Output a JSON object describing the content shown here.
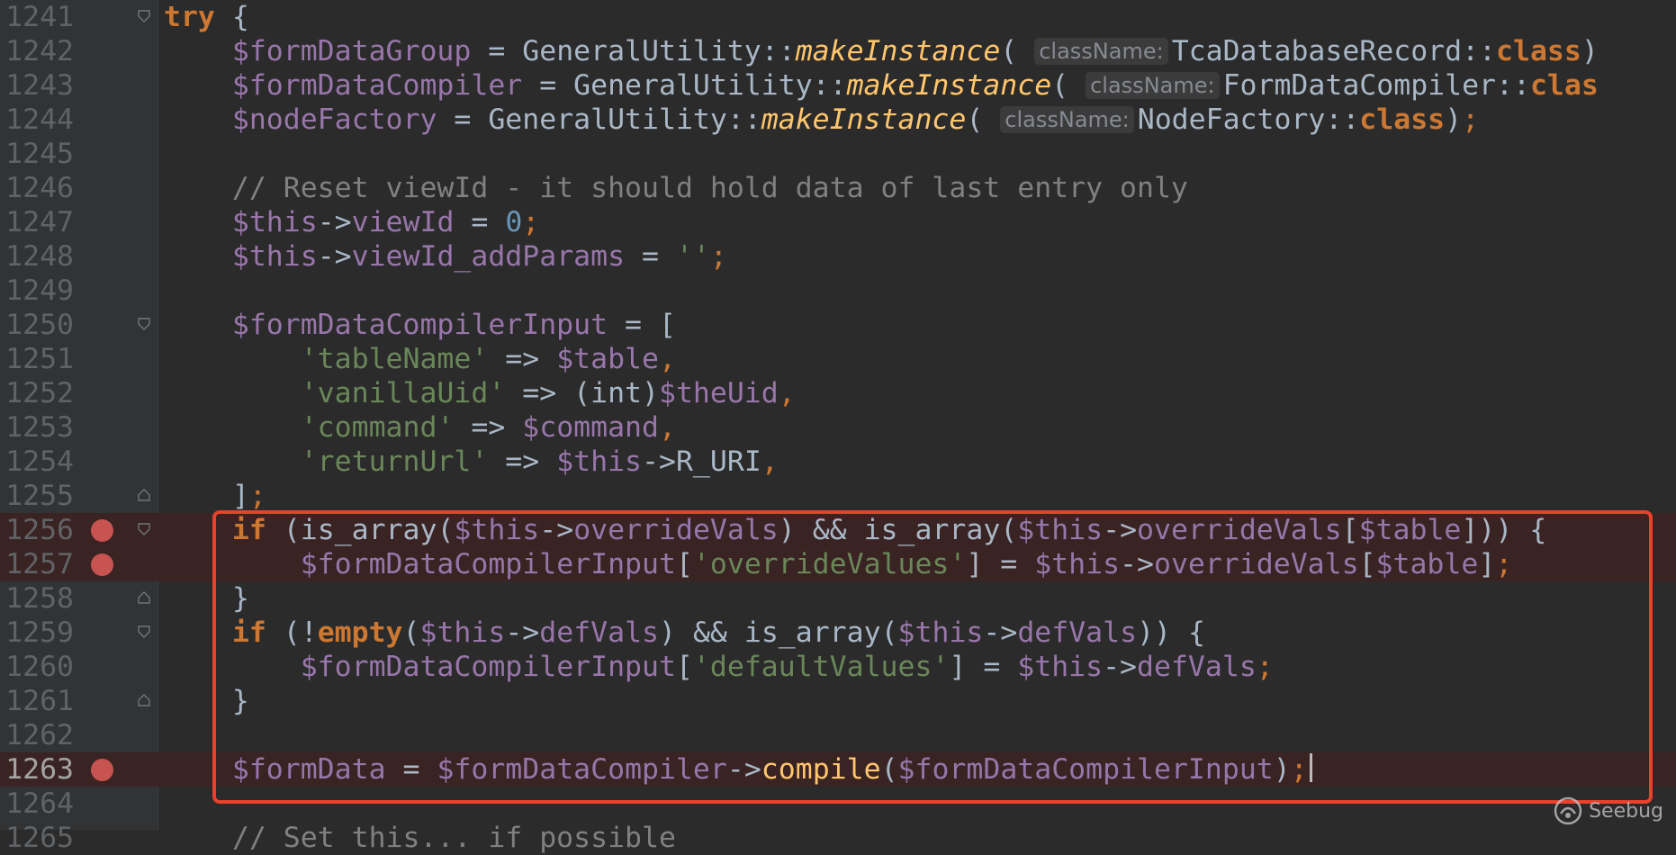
{
  "editor": {
    "watermark": "Seebug",
    "lines": [
      {
        "num": "1241",
        "fold": "open",
        "bp": false,
        "tokens": [
          [
            "kw",
            "try"
          ],
          [
            "t",
            " {"
          ]
        ]
      },
      {
        "num": "1242",
        "fold": "",
        "bp": false,
        "tokens": [
          [
            "t",
            "    "
          ],
          [
            "var",
            "$formDataGroup"
          ],
          [
            "t",
            " = GeneralUtility::"
          ],
          [
            "static",
            "makeInstance"
          ],
          [
            "t",
            "( "
          ],
          [
            "hint",
            "className:"
          ],
          [
            "t",
            "TcaDatabaseRecord::"
          ],
          [
            "kw",
            "class"
          ],
          [
            "t",
            ")"
          ]
        ]
      },
      {
        "num": "1243",
        "fold": "",
        "bp": false,
        "tokens": [
          [
            "t",
            "    "
          ],
          [
            "var",
            "$formDataCompiler"
          ],
          [
            "t",
            " = GeneralUtility::"
          ],
          [
            "static",
            "makeInstance"
          ],
          [
            "t",
            "( "
          ],
          [
            "hint",
            "className:"
          ],
          [
            "t",
            "FormDataCompiler::"
          ],
          [
            "kw",
            "clas"
          ]
        ]
      },
      {
        "num": "1244",
        "fold": "",
        "bp": false,
        "tokens": [
          [
            "t",
            "    "
          ],
          [
            "var",
            "$nodeFactory"
          ],
          [
            "t",
            " = GeneralUtility::"
          ],
          [
            "static",
            "makeInstance"
          ],
          [
            "t",
            "( "
          ],
          [
            "hint",
            "className:"
          ],
          [
            "t",
            "NodeFactory::"
          ],
          [
            "kw",
            "class"
          ],
          [
            "t",
            ")"
          ],
          [
            "kwn",
            ";"
          ]
        ]
      },
      {
        "num": "1245",
        "fold": "",
        "bp": false,
        "tokens": []
      },
      {
        "num": "1246",
        "fold": "",
        "bp": false,
        "tokens": [
          [
            "t",
            "    "
          ],
          [
            "cmt",
            "// Reset viewId - it should hold data of last entry only"
          ]
        ]
      },
      {
        "num": "1247",
        "fold": "",
        "bp": false,
        "tokens": [
          [
            "t",
            "    "
          ],
          [
            "var",
            "$this"
          ],
          [
            "t",
            "->"
          ],
          [
            "var",
            "viewId"
          ],
          [
            "t",
            " = "
          ],
          [
            "num",
            "0"
          ],
          [
            "kwn",
            ";"
          ]
        ]
      },
      {
        "num": "1248",
        "fold": "",
        "bp": false,
        "tokens": [
          [
            "t",
            "    "
          ],
          [
            "var",
            "$this"
          ],
          [
            "t",
            "->"
          ],
          [
            "var",
            "viewId_addParams"
          ],
          [
            "t",
            " = "
          ],
          [
            "str",
            "''"
          ],
          [
            "kwn",
            ";"
          ]
        ]
      },
      {
        "num": "1249",
        "fold": "",
        "bp": false,
        "tokens": []
      },
      {
        "num": "1250",
        "fold": "open",
        "bp": false,
        "tokens": [
          [
            "t",
            "    "
          ],
          [
            "var",
            "$formDataCompilerInput"
          ],
          [
            "t",
            " = ["
          ]
        ]
      },
      {
        "num": "1251",
        "fold": "",
        "bp": false,
        "tokens": [
          [
            "t",
            "        "
          ],
          [
            "str",
            "'tableName'"
          ],
          [
            "t",
            " => "
          ],
          [
            "var",
            "$table"
          ],
          [
            "kwn",
            ","
          ]
        ]
      },
      {
        "num": "1252",
        "fold": "",
        "bp": false,
        "tokens": [
          [
            "t",
            "        "
          ],
          [
            "str",
            "'vanillaUid'"
          ],
          [
            "t",
            " => (int)"
          ],
          [
            "var",
            "$theUid"
          ],
          [
            "kwn",
            ","
          ]
        ]
      },
      {
        "num": "1253",
        "fold": "",
        "bp": false,
        "tokens": [
          [
            "t",
            "        "
          ],
          [
            "str",
            "'command'"
          ],
          [
            "t",
            " => "
          ],
          [
            "var",
            "$command"
          ],
          [
            "kwn",
            ","
          ]
        ]
      },
      {
        "num": "1254",
        "fold": "",
        "bp": false,
        "tokens": [
          [
            "t",
            "        "
          ],
          [
            "str",
            "'returnUrl'"
          ],
          [
            "t",
            " => "
          ],
          [
            "var",
            "$this"
          ],
          [
            "t",
            "->R_URI"
          ],
          [
            "kwn",
            ","
          ]
        ]
      },
      {
        "num": "1255",
        "fold": "close",
        "bp": false,
        "tokens": [
          [
            "t",
            "    ]"
          ],
          [
            "kwn",
            ";"
          ]
        ]
      },
      {
        "num": "1256",
        "fold": "open",
        "bp": true,
        "tokens": [
          [
            "t",
            "    "
          ],
          [
            "kw",
            "if"
          ],
          [
            "t",
            " (is_array("
          ],
          [
            "var",
            "$this"
          ],
          [
            "t",
            "->"
          ],
          [
            "var",
            "overrideVals"
          ],
          [
            "t",
            ") && is_array("
          ],
          [
            "var",
            "$this"
          ],
          [
            "t",
            "->"
          ],
          [
            "var",
            "overrideVals"
          ],
          [
            "t",
            "["
          ],
          [
            "var",
            "$table"
          ],
          [
            "t",
            "])) {"
          ]
        ]
      },
      {
        "num": "1257",
        "fold": "",
        "bp": true,
        "tokens": [
          [
            "t",
            "        "
          ],
          [
            "var",
            "$formDataCompilerInput"
          ],
          [
            "t",
            "["
          ],
          [
            "str",
            "'overrideValues'"
          ],
          [
            "t",
            "] = "
          ],
          [
            "var",
            "$this"
          ],
          [
            "t",
            "->"
          ],
          [
            "var",
            "overrideVals"
          ],
          [
            "t",
            "["
          ],
          [
            "var",
            "$table"
          ],
          [
            "t",
            "]"
          ],
          [
            "kwn",
            ";"
          ]
        ]
      },
      {
        "num": "1258",
        "fold": "close",
        "bp": false,
        "tokens": [
          [
            "t",
            "    }"
          ]
        ]
      },
      {
        "num": "1259",
        "fold": "open",
        "bp": false,
        "tokens": [
          [
            "t",
            "    "
          ],
          [
            "kw",
            "if"
          ],
          [
            "t",
            " (!"
          ],
          [
            "kw",
            "empty"
          ],
          [
            "t",
            "("
          ],
          [
            "var",
            "$this"
          ],
          [
            "t",
            "->"
          ],
          [
            "var",
            "defVals"
          ],
          [
            "t",
            ") && is_array("
          ],
          [
            "var",
            "$this"
          ],
          [
            "t",
            "->"
          ],
          [
            "var",
            "defVals"
          ],
          [
            "t",
            ")) {"
          ]
        ]
      },
      {
        "num": "1260",
        "fold": "",
        "bp": false,
        "tokens": [
          [
            "t",
            "        "
          ],
          [
            "var",
            "$formDataCompilerInput"
          ],
          [
            "t",
            "["
          ],
          [
            "str",
            "'defaultValues'"
          ],
          [
            "t",
            "] = "
          ],
          [
            "var",
            "$this"
          ],
          [
            "t",
            "->"
          ],
          [
            "var",
            "defVals"
          ],
          [
            "kwn",
            ";"
          ]
        ]
      },
      {
        "num": "1261",
        "fold": "close",
        "bp": false,
        "tokens": [
          [
            "t",
            "    }"
          ]
        ]
      },
      {
        "num": "1262",
        "fold": "",
        "bp": false,
        "tokens": []
      },
      {
        "num": "1263",
        "fold": "",
        "bp": true,
        "current": true,
        "tokens": [
          [
            "t",
            "    "
          ],
          [
            "var",
            "$formData"
          ],
          [
            "t",
            " = "
          ],
          [
            "var",
            "$formDataCompiler"
          ],
          [
            "t",
            "->"
          ],
          [
            "fn",
            "compile"
          ],
          [
            "t",
            "("
          ],
          [
            "var",
            "$formDataCompilerInput"
          ],
          [
            "t",
            ")"
          ],
          [
            "kwn",
            ";"
          ],
          [
            "caret",
            ""
          ]
        ]
      },
      {
        "num": "1264",
        "fold": "",
        "bp": false,
        "tokens": []
      },
      {
        "num": "1265",
        "fold": "",
        "bp": false,
        "tokens": [
          [
            "t",
            "    "
          ],
          [
            "cmt",
            "// Set this... if possible"
          ]
        ]
      }
    ]
  }
}
